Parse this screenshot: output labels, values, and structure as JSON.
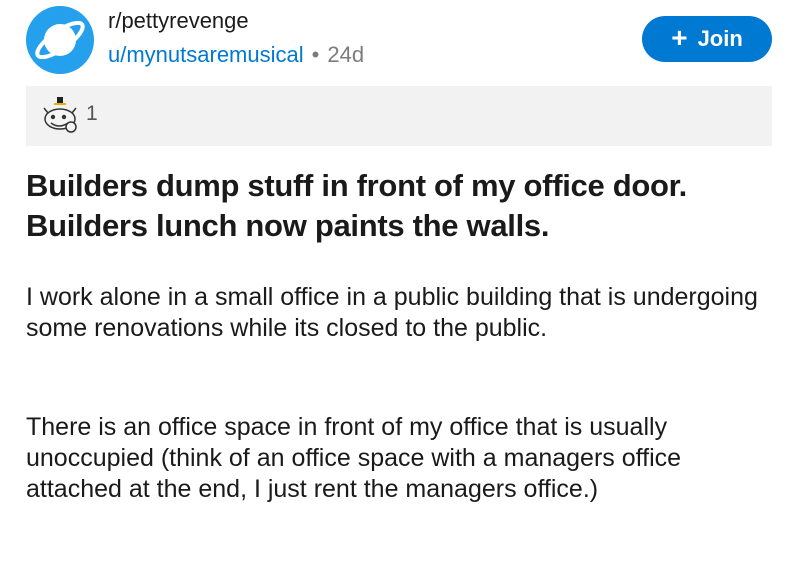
{
  "post": {
    "subreddit": "r/pettyrevenge",
    "author": "u/mynutsaremusical",
    "separator": "•",
    "age": "24d",
    "join_label": "Join",
    "join_icon": "plus-icon",
    "award": {
      "icon": "wholesome-award-icon",
      "count": "1"
    },
    "title": "Builders dump stuff in front of my office door. Builders lunch now paints the walls.",
    "paragraphs": [
      "I work alone in a small office in a public building that is undergoing some renovations while its closed to the public.",
      "There is an office space in front of my office that is usually unoccupied (think of an office space with a managers office attached at the end, I just rent the managers office.)"
    ]
  },
  "colors": {
    "accent": "#0079d3",
    "subreddit_avatar": "#24a0ed",
    "award_bar": "#f2f2f2"
  }
}
